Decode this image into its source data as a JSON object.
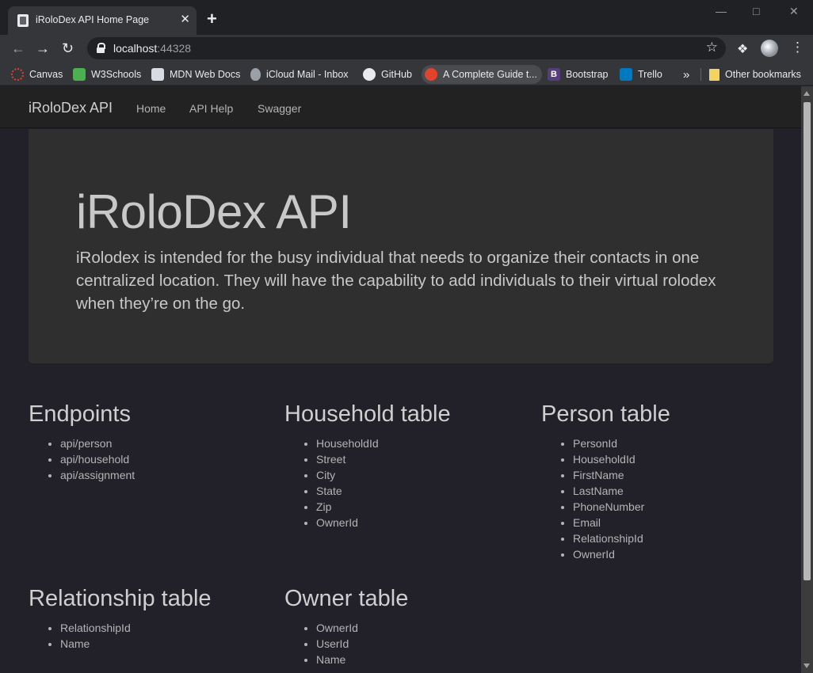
{
  "browser": {
    "tab_title": "iRoloDex API Home Page",
    "tab_close": "✕",
    "new_tab": "+",
    "url_host": "localhost",
    "url_port": ":44328",
    "bookmarks": [
      {
        "label": "Canvas",
        "icon": "canvas-icon",
        "color": "#e2432a"
      },
      {
        "label": "W3Schools",
        "icon": "w3schools-icon",
        "color": "#4caf50"
      },
      {
        "label": "MDN Web Docs",
        "icon": "mdn-icon",
        "color": "#d7dce2"
      },
      {
        "label": "iCloud Mail - Inbox",
        "icon": "apple-icon",
        "color": "#9aa0a6"
      },
      {
        "label": "GitHub",
        "icon": "github-icon",
        "color": "#e8eaed"
      },
      {
        "label": "A Complete Guide t...",
        "icon": "css-tricks-icon",
        "color": "#e0442d"
      },
      {
        "label": "Bootstrap",
        "icon": "bootstrap-icon",
        "color": "#563d7c"
      },
      {
        "label": "Trello",
        "icon": "trello-icon",
        "color": "#0079bf"
      }
    ],
    "more_bookmarks": "»",
    "other_bookmarks": "Other bookmarks"
  },
  "site": {
    "brand": "iRoloDex API",
    "nav": [
      "Home",
      "API Help",
      "Swagger"
    ],
    "jumbotron": {
      "title": "iRoloDex API",
      "lead": "iRolodex is intended for the busy individual that needs to organize their contacts in one centralized location. They will have the capability to add individuals to their virtual rolodex when they’re on the go."
    },
    "sections": [
      {
        "title": "Endpoints",
        "items": [
          "api/person",
          "api/household",
          "api/assignment"
        ]
      },
      {
        "title": "Household table",
        "items": [
          "HouseholdId",
          "Street",
          "City",
          "State",
          "Zip",
          "OwnerId"
        ]
      },
      {
        "title": "Person table",
        "items": [
          "PersonId",
          "HouseholdId",
          "FirstName",
          "LastName",
          "PhoneNumber",
          "Email",
          "RelationshipId",
          "OwnerId"
        ]
      },
      {
        "title": "Relationship table",
        "items": [
          "RelationshipId",
          "Name"
        ]
      },
      {
        "title": "Owner table",
        "items": [
          "OwnerId",
          "UserId",
          "Name"
        ]
      }
    ]
  }
}
